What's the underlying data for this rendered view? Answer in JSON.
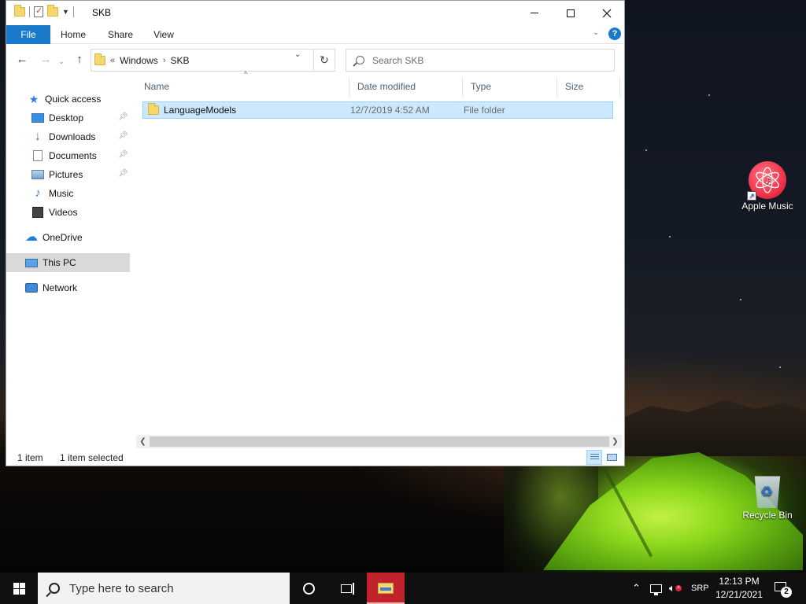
{
  "window": {
    "title": "SKB",
    "controls": {
      "minimize": "minimize",
      "maximize": "maximize",
      "close": "close"
    }
  },
  "ribbon": {
    "tabs": [
      "File",
      "Home",
      "Share",
      "View"
    ],
    "help": "?"
  },
  "address": {
    "overflow": "«",
    "crumbs": [
      "Windows",
      "SKB"
    ],
    "separator": "›"
  },
  "search": {
    "placeholder": "Search SKB"
  },
  "nav_pane": {
    "items": [
      {
        "label": "Quick access",
        "icon": "star-icon"
      },
      {
        "label": "Desktop",
        "icon": "desktop-icon",
        "pinned": true
      },
      {
        "label": "Downloads",
        "icon": "download-icon",
        "pinned": true
      },
      {
        "label": "Documents",
        "icon": "document-icon",
        "pinned": true
      },
      {
        "label": "Pictures",
        "icon": "pictures-icon",
        "pinned": true
      },
      {
        "label": "Music",
        "icon": "music-icon"
      },
      {
        "label": "Videos",
        "icon": "video-icon"
      },
      {
        "label": "OneDrive",
        "icon": "cloud-icon"
      },
      {
        "label": "This PC",
        "icon": "computer-icon",
        "selected": true
      },
      {
        "label": "Network",
        "icon": "network-icon"
      }
    ]
  },
  "columns": [
    "Name",
    "Date modified",
    "Type",
    "Size"
  ],
  "files": [
    {
      "name": "LanguageModels",
      "date": "12/7/2019 4:52 AM",
      "type": "File folder",
      "size": ""
    }
  ],
  "status": {
    "count": "1 item",
    "selected": "1 item selected"
  },
  "desktop_icons": [
    {
      "label": "Apple Music",
      "icon": "apple-music-icon"
    },
    {
      "label": "Recycle Bin",
      "icon": "recycle-bin-icon"
    }
  ],
  "taskbar": {
    "search_placeholder": "Type here to search",
    "language": "SRP",
    "time": "12:13 PM",
    "date": "12/21/2021",
    "notifications": "2"
  },
  "colors": {
    "accent": "#1979ca",
    "selection": "#cce8ff",
    "taskbar_active": "#c0232c"
  }
}
